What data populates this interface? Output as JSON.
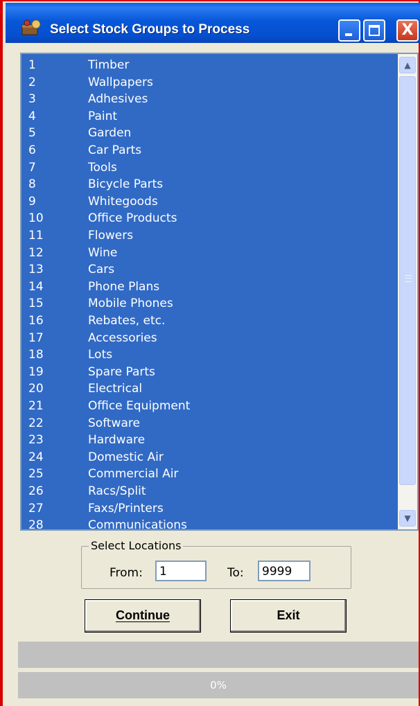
{
  "window": {
    "title": "Select Stock Groups to Process",
    "controls": {
      "minimize_icon": "minimize-icon",
      "maximize_icon": "maximize-icon",
      "close_icon": "close-icon",
      "close_glyph": "X"
    }
  },
  "stock_groups": {
    "items": [
      {
        "num": "1",
        "name": "Timber"
      },
      {
        "num": "2",
        "name": "Wallpapers"
      },
      {
        "num": "3",
        "name": "Adhesives"
      },
      {
        "num": "4",
        "name": "Paint"
      },
      {
        "num": "5",
        "name": "Garden"
      },
      {
        "num": "6",
        "name": "Car Parts"
      },
      {
        "num": "7",
        "name": "Tools"
      },
      {
        "num": "8",
        "name": "Bicycle Parts"
      },
      {
        "num": "9",
        "name": "Whitegoods"
      },
      {
        "num": "10",
        "name": "Office Products"
      },
      {
        "num": "11",
        "name": "Flowers"
      },
      {
        "num": "12",
        "name": "Wine"
      },
      {
        "num": "13",
        "name": "Cars"
      },
      {
        "num": "14",
        "name": "Phone Plans"
      },
      {
        "num": "15",
        "name": "Mobile Phones"
      },
      {
        "num": "16",
        "name": "Rebates, etc."
      },
      {
        "num": "17",
        "name": "Accessories"
      },
      {
        "num": "18",
        "name": "Lots"
      },
      {
        "num": "19",
        "name": "Spare Parts"
      },
      {
        "num": "20",
        "name": "Electrical"
      },
      {
        "num": "21",
        "name": "Office Equipment"
      },
      {
        "num": "22",
        "name": "Software"
      },
      {
        "num": "23",
        "name": "Hardware"
      },
      {
        "num": "24",
        "name": "Domestic Air"
      },
      {
        "num": "25",
        "name": "Commercial Air"
      },
      {
        "num": "26",
        "name": "Racs/Split"
      },
      {
        "num": "27",
        "name": "Faxs/Printers"
      },
      {
        "num": "28",
        "name": "Communications"
      }
    ],
    "selection_color": "#316ac5",
    "scroll_up_glyph": "▲",
    "scroll_down_glyph": "▼"
  },
  "locations": {
    "legend": "Select Locations",
    "from_label": "From:",
    "from_value": "1",
    "to_label": "To:",
    "to_value": "9999"
  },
  "buttons": {
    "continue_label": "Continue",
    "exit_label": "Exit"
  },
  "progress": {
    "text": "0%",
    "value": 0
  }
}
